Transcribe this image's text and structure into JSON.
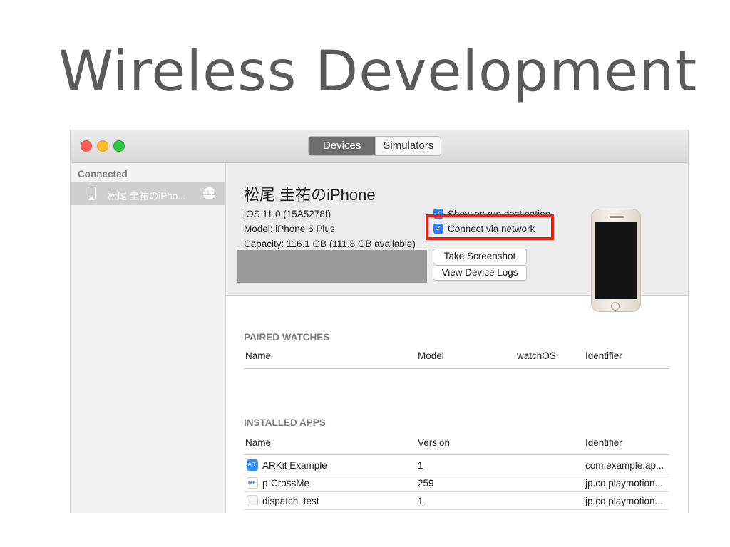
{
  "slide": {
    "title": "Wireless Development"
  },
  "window": {
    "tabs": [
      {
        "label": "Devices",
        "active": true
      },
      {
        "label": "Simulators",
        "active": false
      }
    ],
    "sidebar": {
      "heading": "Connected",
      "items": [
        {
          "label": "松尾 圭祐のiPho...",
          "badge": "11.0"
        }
      ]
    },
    "device": {
      "name": "松尾 圭祐のiPhone",
      "os": "iOS 11.0 (15A5278f)",
      "model": "Model: iPhone 6 Plus",
      "capacity": "Capacity: 116.1 GB (111.8 GB available)",
      "options": [
        {
          "label": "Show as run destination",
          "checked": true
        },
        {
          "label": "Connect via network",
          "checked": true,
          "highlighted": true
        }
      ],
      "buttons": {
        "screenshot": "Take Screenshot",
        "logs": "View Device Logs"
      }
    },
    "paired_watches": {
      "title": "PAIRED WATCHES",
      "columns": [
        "Name",
        "Model",
        "watchOS",
        "Identifier"
      ],
      "rows": []
    },
    "installed_apps": {
      "title": "INSTALLED APPS",
      "columns": [
        "Name",
        "Version",
        "Identifier"
      ],
      "rows": [
        {
          "name": "ARKit Example",
          "version": "1",
          "identifier": "com.example.ap...",
          "icon": "arkit-app-icon"
        },
        {
          "name": "p-CrossMe",
          "version": "259",
          "identifier": "jp.co.playmotion...",
          "icon": "crossme-app-icon"
        },
        {
          "name": "dispatch_test",
          "version": "1",
          "identifier": "jp.co.playmotion...",
          "icon": "blank-app-icon"
        }
      ]
    },
    "colors": {
      "accent": "#2c7ef6",
      "highlight": "#ec1d15",
      "selection": "#cfcfcf"
    }
  }
}
